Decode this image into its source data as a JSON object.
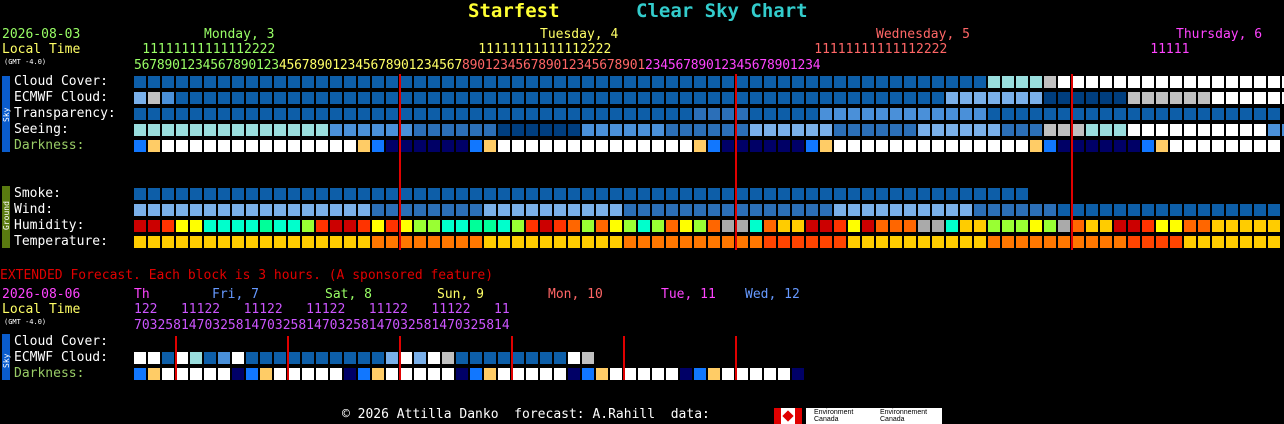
{
  "titles": {
    "left": "Starfest",
    "right": "Clear Sky Chart",
    "left_color": "#ffff33",
    "right_color": "#33cccc"
  },
  "top": {
    "date": "2026-08-03",
    "local_time": "Local Time",
    "gmt": "(GMT -4.0)",
    "days": [
      {
        "label": "Monday, 3",
        "color": "#99ff66"
      },
      {
        "label": "Tuesday, 4",
        "color": "#ffff66"
      },
      {
        "label": "Wednesday, 5",
        "color": "#ff6666"
      },
      {
        "label": "Thursday, 6",
        "color": "#ff44ff"
      }
    ],
    "hour_tens": [
      "          11111111111112222",
      "          11111111111112222",
      "          11111111111112222",
      "          11111"
    ],
    "hours": "567890123456789012345678901234567890123456789012345678901234567890123456789012345678901234",
    "sky_labels": [
      "Cloud Cover:",
      "ECMWF Cloud:",
      "Transparency:",
      "Seeing:",
      "Darkness:"
    ],
    "ground_labels": [
      "Smoke:",
      "Wind:",
      "Humidity:",
      "Temperature:"
    ],
    "sky_tag": "Sky",
    "ground_tag": "Ground"
  },
  "extended": {
    "note": "EXTENDED Forecast. Each block is 3 hours. (A sponsored feature)",
    "date": "2026-08-06",
    "local_time": "Local Time",
    "gmt": "(GMT -4.0)",
    "days": [
      {
        "label": "Th",
        "color": "#ff44ff"
      },
      {
        "label": "Fri, 7",
        "color": "#6699ff"
      },
      {
        "label": "Sat, 8",
        "color": "#99ff66"
      },
      {
        "label": "Sun, 9",
        "color": "#ffff66"
      },
      {
        "label": "Mon, 10",
        "color": "#ff6666"
      },
      {
        "label": "Tue, 11",
        "color": "#ff44ff"
      },
      {
        "label": "Wed, 12",
        "color": "#6699ff"
      }
    ],
    "hour_tens": "122   11122   11122   11122   11122   11122   11",
    "hours": "703258147032581470325814703258147032581470325814",
    "labels": [
      "Cloud Cover:",
      "ECMWF Cloud:",
      "Darkness:"
    ],
    "sky_tag": "Sky"
  },
  "footer": {
    "text": "© 2026 Attilla Danko  forecast: A.Rahill  data:",
    "env1": "Environment Canada",
    "env2": "Environnement Canada"
  },
  "colors": {
    "dark_blue": "#003e7e",
    "blue": "#0d5ea8",
    "mid_blue": "#2b6fb8",
    "light_blue": "#4a90d9",
    "sky_blue": "#7ab0ea",
    "pale_cyan": "#99dddd",
    "gray": "#c0c0c0",
    "white": "#ffffff",
    "darkness_navy": "#000066",
    "darkness_blue": "#0033cc",
    "darkness_tan": "#ffe4a8",
    "red_line": "#e00000"
  }
}
